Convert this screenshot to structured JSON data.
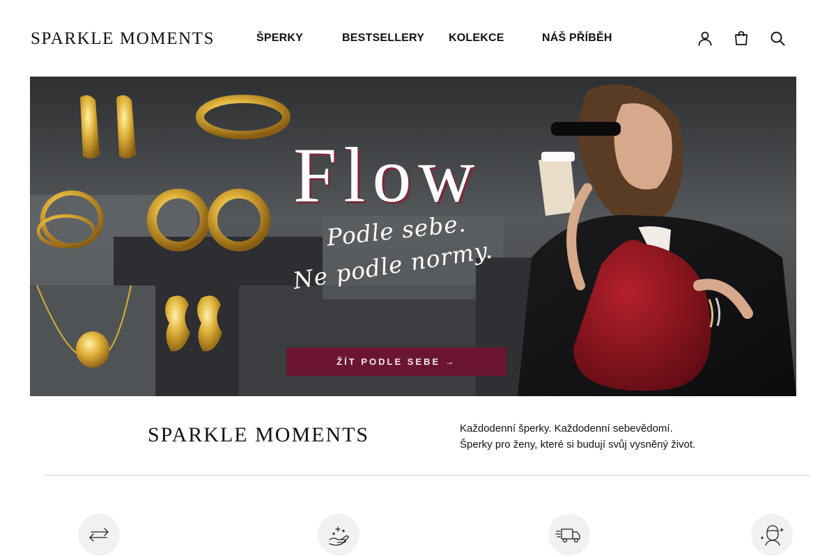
{
  "header": {
    "logo": "SPARKLE  MOMENTS",
    "nav": [
      {
        "label": "ŠPERKY"
      },
      {
        "label": "BESTSELLERY"
      },
      {
        "label": "KOLEKCE"
      },
      {
        "label": "NÁŠ PŘÍBĚH"
      }
    ],
    "icons": [
      "account-icon",
      "cart-icon",
      "search-icon"
    ]
  },
  "hero": {
    "title": "Flow",
    "line1": "Podle sebe.",
    "line2": "Ne podle normy.",
    "cta": "ŽÍT PODLE SEBE →",
    "accent_color": "#6b1630"
  },
  "brand": {
    "logo": "SPARKLE  MOMENTS",
    "tagline_1": "Každodenní šperky. Každodenní sebevědomí.",
    "tagline_2": "Šperky pro ženy, které si budují svůj vysněný život."
  },
  "features": [
    {
      "icon": "exchange-arrows-icon"
    },
    {
      "icon": "hand-sparkle-icon"
    },
    {
      "icon": "delivery-truck-icon"
    },
    {
      "icon": "woman-sparkle-icon"
    }
  ]
}
